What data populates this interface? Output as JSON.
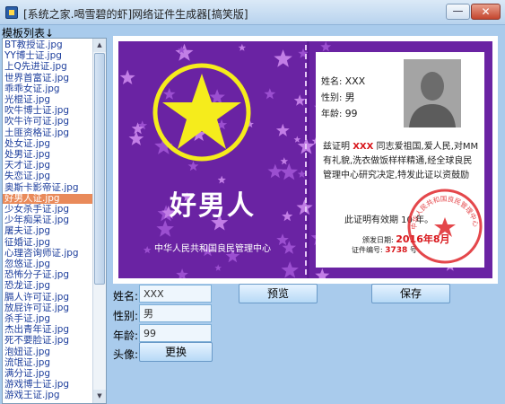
{
  "window": {
    "title": "[系统之家.喝雪碧的虾]网络证件生成器[搞笑版]",
    "minimize_glyph": "—",
    "close_glyph": "✕"
  },
  "sidebar": {
    "label": "模板列表",
    "arrow_glyph": "↓",
    "items": [
      "BT教授证.jpg",
      "YY博士证.jpg",
      "上Q先进证.jpg",
      "世界首富证.jpg",
      "乖乖女证.jpg",
      "光棍证.jpg",
      "吹牛博士证.jpg",
      "吹牛许可证.jpg",
      "土匪资格证.jpg",
      "处女证.jpg",
      "处男证.jpg",
      "天才证.jpg",
      "失恋证.jpg",
      "奥斯卡影帝证.jpg",
      "好男人证.jpg",
      "少女杀手证.jpg",
      "少年痴呆证.jpg",
      "屠夫证.jpg",
      "征婚证.jpg",
      "心理咨询师证.jpg",
      "忽悠证.jpg",
      "恐怖分子证.jpg",
      "恐龙证.jpg",
      "膈人许可证.jpg",
      "放屁许可证.jpg",
      "杀手证.jpg",
      "杰出青年证.jpg",
      "死不要脸证.jpg",
      "泡妞证.jpg",
      "流氓证.jpg",
      "满分证.jpg",
      "游戏博士证.jpg",
      "游戏王证.jpg"
    ],
    "selected_index": 14,
    "scroll_up_glyph": "▲",
    "scroll_down_glyph": "▼"
  },
  "certificate": {
    "title": "好男人",
    "issuer": "中华人民共和国良民管理中心",
    "fields": {
      "name_label": "姓名:",
      "name_value": "XXX",
      "gender_label": "性别:",
      "gender_value": "男",
      "age_label": "年龄:",
      "age_value": "99"
    },
    "body_prefix": "兹证明",
    "body_name": "XXX",
    "body_text": "同志爱祖国,爱人民,对MM有礼貌,洗衣做饭样样精通,经全球良民管理中心研究决定,特发此证以资鼓励",
    "validity": "此证明有效期 10 年。",
    "issue_label": "颁发日期:",
    "issue_date": "2016年8月",
    "serial_label": "证件编号:",
    "serial_value": "3738",
    "serial_suffix": "号",
    "seal_text": "中华人民共和国良民管理中心专用证件",
    "colors": {
      "card": "#6a23a3",
      "star": "#f5ec1c",
      "red": "#d8161b"
    }
  },
  "form": {
    "name_label": "姓名:",
    "name_value": "XXX",
    "gender_label": "性别:",
    "gender_value": "男",
    "age_label": "年龄:",
    "age_value": "99",
    "avatar_label": "头像:",
    "change_button": "更换",
    "preview_button": "预览",
    "save_button": "保存"
  }
}
